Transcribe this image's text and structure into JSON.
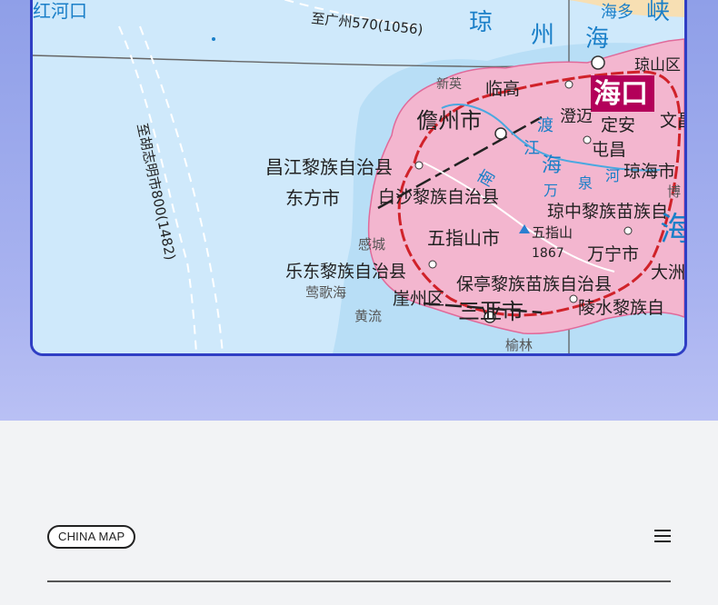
{
  "header": {
    "badge_label": "CHINA MAP",
    "menu_icon": "hamburger-icon"
  },
  "map": {
    "colors": {
      "sea": "#cfe9fb",
      "island": "#f3b6cf",
      "railway": "#d0222a",
      "capital_box": "#b3005a"
    },
    "labels": {
      "honghekou": "红河口",
      "to_guangzhou": "至广州570(1056)",
      "strait_1": "琼",
      "strait_2": "州",
      "strait_3": "海",
      "strait_4": "峡",
      "strait_5": "海多",
      "to_hcm": "至胡志明市800(1482)",
      "haikou": "海口",
      "qiongshan": "琼山区",
      "xinying": "新英",
      "lingao": "临高",
      "danzhou": "儋州市",
      "chengmai": "澄迈",
      "dingan": "定安",
      "wenchang": "文昌",
      "tunchang": "屯昌",
      "changjiang": "昌江黎族自治县",
      "qionghai": "琼海市",
      "dongfang": "东方市",
      "baisha": "白沙黎族自治县",
      "qiongzhong": "琼中黎族苗族自",
      "wuzhishan_city": "五指山市",
      "wuzhishan_peak": "五指山",
      "peak_height": "1867",
      "wanning": "万宁市",
      "sea_east": "海",
      "dazhou": "大洲",
      "ganchen": "感城",
      "ledong": "乐东黎族自治县",
      "yinggehai": "莺歌海",
      "baoting": "保亭黎族苗族自治县",
      "yazhou": "崖州区",
      "huangliu": "黄流",
      "sanya": "三亚市",
      "lingshui": "陵水黎族自",
      "yulin": "榆林",
      "river_1": "南",
      "river_2": "渡",
      "river_3": "江",
      "river_4": "万",
      "river_5": "泉",
      "river_6": "河",
      "sea_haikou": "海",
      "bo": "博"
    }
  }
}
